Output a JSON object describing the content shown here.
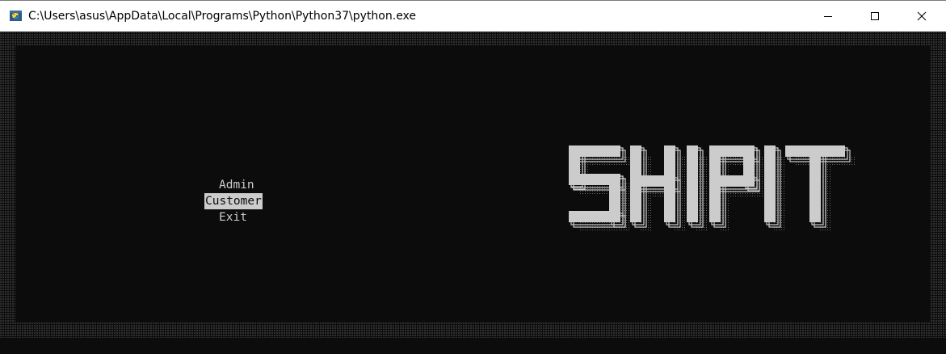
{
  "window": {
    "title": "C:\\Users\\asus\\AppData\\Local\\Programs\\Python\\Python37\\python.exe",
    "icon": "python-icon",
    "controls": [
      "minimize-icon",
      "maximize-icon",
      "close-icon"
    ]
  },
  "menu": {
    "items": [
      {
        "label": "Admin",
        "selected": false
      },
      {
        "label": "Customer",
        "selected": true
      },
      {
        "label": "Exit",
        "selected": false
      }
    ]
  },
  "logo": {
    "text": "SHIPIT"
  },
  "colors": {
    "console_bg": "#0c0c0c",
    "console_text": "#cccccc",
    "selection_bg": "#cccccc",
    "selection_text": "#0c0c0c",
    "titlebar_bg": "#ffffff",
    "dither": "#5e5e5e"
  }
}
